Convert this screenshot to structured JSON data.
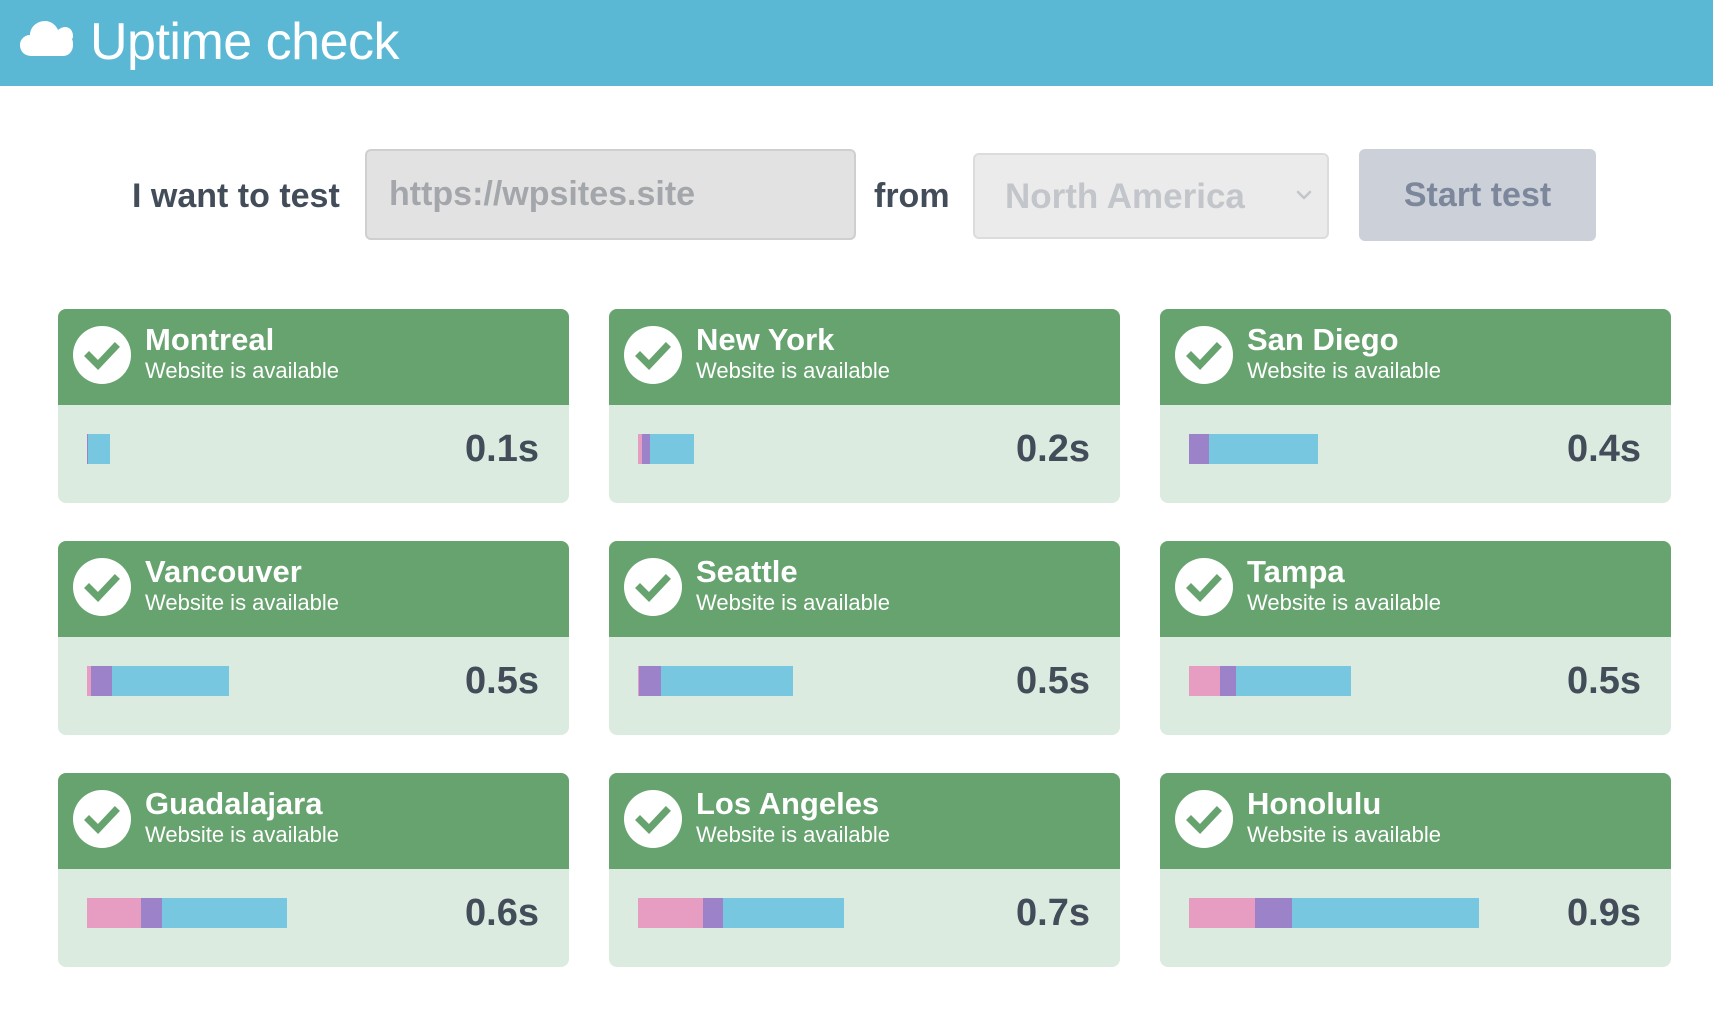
{
  "header": {
    "icon": "cloud-icon",
    "title": "Uptime check"
  },
  "form": {
    "test_label": "I want to test",
    "url_placeholder": "https://wpsites.site",
    "url_value": "",
    "from_label": "from",
    "region_selected": "North America",
    "start_button": "Start test"
  },
  "colors": {
    "header_bg": "#5bb8d4",
    "card_header_bg": "#67a36f",
    "card_body_bg": "#dbebdf",
    "segment_pink": "#e79cc2",
    "segment_purple": "#9b82c9",
    "segment_blue": "#78c7e1"
  },
  "results": [
    {
      "city": "Montreal",
      "status": "Website is available",
      "time": "0.1s",
      "segments": {
        "pink": 0.0,
        "purple": 0.003,
        "blue": 0.07
      }
    },
    {
      "city": "New York",
      "status": "Website is available",
      "time": "0.2s",
      "segments": {
        "pink": 0.013,
        "purple": 0.025,
        "blue": 0.137
      }
    },
    {
      "city": "San Diego",
      "status": "Website is available",
      "time": "0.4s",
      "segments": {
        "pink": 0.0,
        "purple": 0.063,
        "blue": 0.34
      }
    },
    {
      "city": "Vancouver",
      "status": "Website is available",
      "time": "0.5s",
      "segments": {
        "pink": 0.013,
        "purple": 0.065,
        "blue": 0.365
      }
    },
    {
      "city": "Seattle",
      "status": "Website is available",
      "time": "0.5s",
      "segments": {
        "pink": 0.003,
        "purple": 0.069,
        "blue": 0.412
      }
    },
    {
      "city": "Tampa",
      "status": "Website is available",
      "time": "0.5s",
      "segments": {
        "pink": 0.097,
        "purple": 0.05,
        "blue": 0.36
      }
    },
    {
      "city": "Guadalajara",
      "status": "Website is available",
      "time": "0.6s",
      "segments": {
        "pink": 0.168,
        "purple": 0.066,
        "blue": 0.39
      }
    },
    {
      "city": "Los Angeles",
      "status": "Website is available",
      "time": "0.7s",
      "segments": {
        "pink": 0.203,
        "purple": 0.062,
        "blue": 0.378
      }
    },
    {
      "city": "Honolulu",
      "status": "Website is available",
      "time": "0.9s",
      "segments": {
        "pink": 0.206,
        "purple": 0.116,
        "blue": 0.584
      }
    }
  ]
}
